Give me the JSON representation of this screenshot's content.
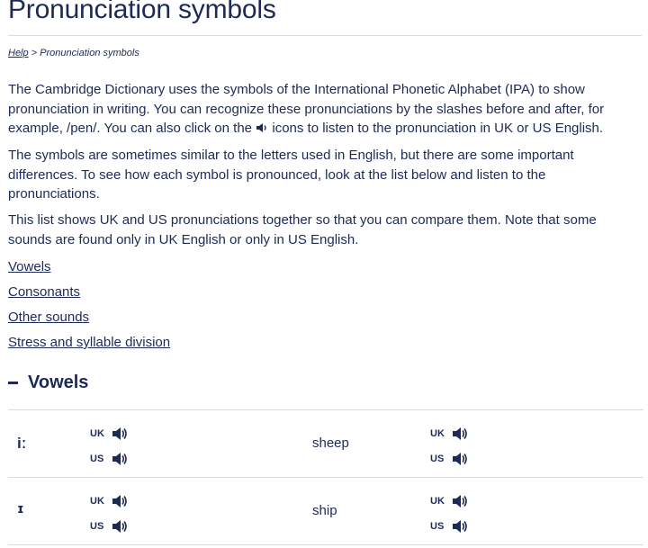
{
  "page": {
    "title": "Pronunciation symbols"
  },
  "breadcrumb": {
    "parent": "Help",
    "separator": " > ",
    "current": "Pronunciation symbols"
  },
  "intro": {
    "paragraph1_before_icon": "The Cambridge Dictionary uses the symbols of the International Phonetic Alphabet (IPA) to show pronunciation in writing. You can recognize these pronunciations by the slashes before and after, for example, /pen/. You can also click on the ",
    "paragraph1_after_icon": " icons to listen to the pronunciation in UK or US English.",
    "paragraph2": "The symbols are sometimes similar to the letters used in English, but there are some important differences. To see how each symbol is pronounced, look at the list below and listen to the pronunciations.",
    "paragraph3": "This list shows UK and US pronunciations together so that you can compare them. Note that some sounds are found only in UK English or only in US English."
  },
  "toc": [
    "Vowels",
    "Consonants",
    "Other sounds",
    "Stress and syllable division"
  ],
  "section": {
    "title": "Vowels"
  },
  "rows": [
    {
      "symbol": "iː",
      "word_before": "sh",
      "word_highlight": "ee",
      "word_after": "p",
      "uk": "UK",
      "us": "US"
    },
    {
      "symbol": "ɪ",
      "word_before": "sh",
      "word_highlight": "i",
      "word_after": "p",
      "uk": "UK",
      "us": "US"
    }
  ],
  "colors": {
    "text": "#1d2a57",
    "rule": "#d8dbe3",
    "background": "#ffffff"
  }
}
